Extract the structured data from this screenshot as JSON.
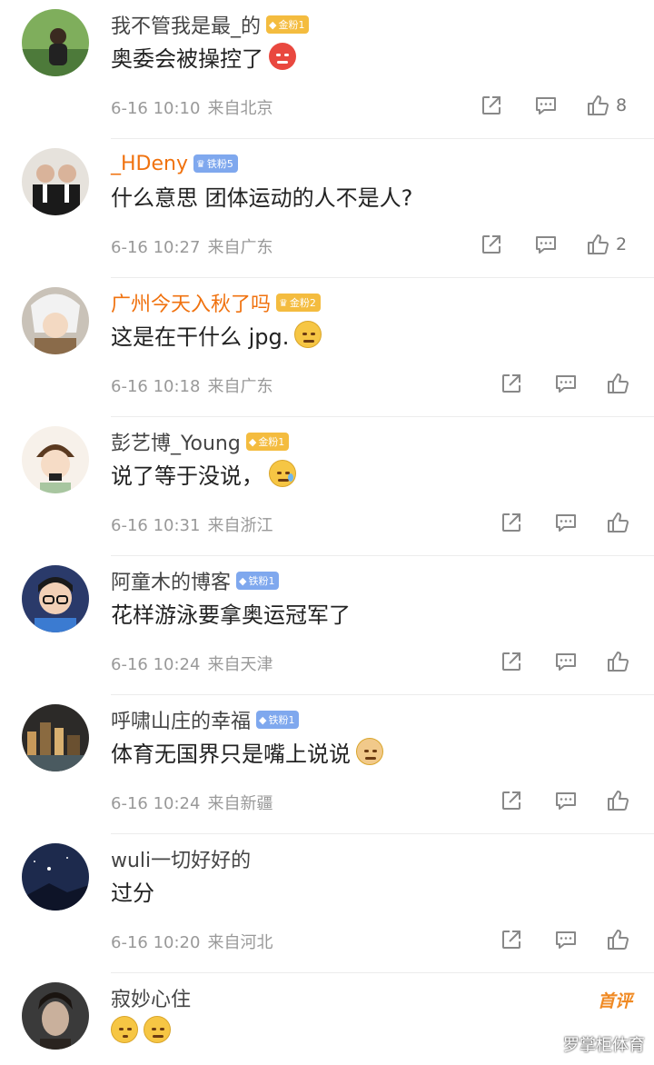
{
  "comments": [
    {
      "username": "我不管我是最_的",
      "fan_badge": "金粉1",
      "fan_type": "gold",
      "text": "奥委会被操控了",
      "emoji": "angry-face",
      "time": "6-16 10:10",
      "source": "来自北京",
      "likes": "8",
      "avatar_colors": [
        "#4d7a3a",
        "#8fbf6a"
      ]
    },
    {
      "username": "_HDeny",
      "fan_badge": "铁粉5",
      "fan_type": "iron",
      "text": "什么意思 团体运动的人不是人?",
      "emoji": "",
      "time": "6-16 10:27",
      "source": "来自广东",
      "likes": "2",
      "avatar_colors": [
        "#1a1a1a",
        "#d8d8d8"
      ]
    },
    {
      "username": "广州今天入秋了吗",
      "fan_badge": "金粉2",
      "fan_type": "gold",
      "text": "这是在干什么 jpg.",
      "emoji": "thinking-face",
      "time": "6-16 10:18",
      "source": "来自广东",
      "likes": "",
      "avatar_colors": [
        "#d9cfc2",
        "#f3e6d4"
      ]
    },
    {
      "username": "彭艺博_Young",
      "fan_badge": "金粉1",
      "fan_type": "gold",
      "text": "说了等于没说，",
      "emoji": "sweat-face",
      "time": "6-16 10:31",
      "source": "来自浙江",
      "likes": "",
      "avatar_colors": [
        "#f1e4d4",
        "#5b3a20"
      ]
    },
    {
      "username": "阿童木的博客",
      "fan_badge": "铁粉1",
      "fan_type": "iron",
      "text": "花样游泳要拿奥运冠军了",
      "emoji": "",
      "time": "6-16 10:24",
      "source": "来自天津",
      "likes": "",
      "avatar_colors": [
        "#3b7bd1",
        "#1f2740"
      ]
    },
    {
      "username": "呼啸山庄的幸福",
      "fan_badge": "铁粉1",
      "fan_type": "iron",
      "text": "体育无国界只是嘴上说说",
      "emoji": "doge-face",
      "time": "6-16 10:24",
      "source": "来自新疆",
      "likes": "",
      "avatar_colors": [
        "#2c2a28",
        "#c7995a"
      ]
    },
    {
      "username": "wuli一切好好的",
      "fan_badge": "",
      "fan_type": "",
      "text": "过分",
      "emoji": "",
      "time": "6-16 10:20",
      "source": "来自河北",
      "likes": "",
      "avatar_colors": [
        "#1d2a4d",
        "#3d5a9a"
      ]
    },
    {
      "username": "寂妙心住",
      "fan_badge": "",
      "fan_type": "",
      "text": "",
      "emoji": "shush-face, sleepy-face",
      "time": "",
      "source": "",
      "likes": "",
      "avatar_colors": [
        "#3a3a3a",
        "#b9a99a"
      ]
    }
  ],
  "first_comment_tag": "首评",
  "watermark": "罗掌柜体育",
  "icons": {
    "share": "share-icon",
    "reply": "comment-icon",
    "like": "thumbs-up-icon"
  },
  "colors": {
    "username": "#444444",
    "vip_username": "#f0720f",
    "gold_badge": "#f4bc3f",
    "iron_badge": "#7fa8ee",
    "meta": "#999999"
  }
}
